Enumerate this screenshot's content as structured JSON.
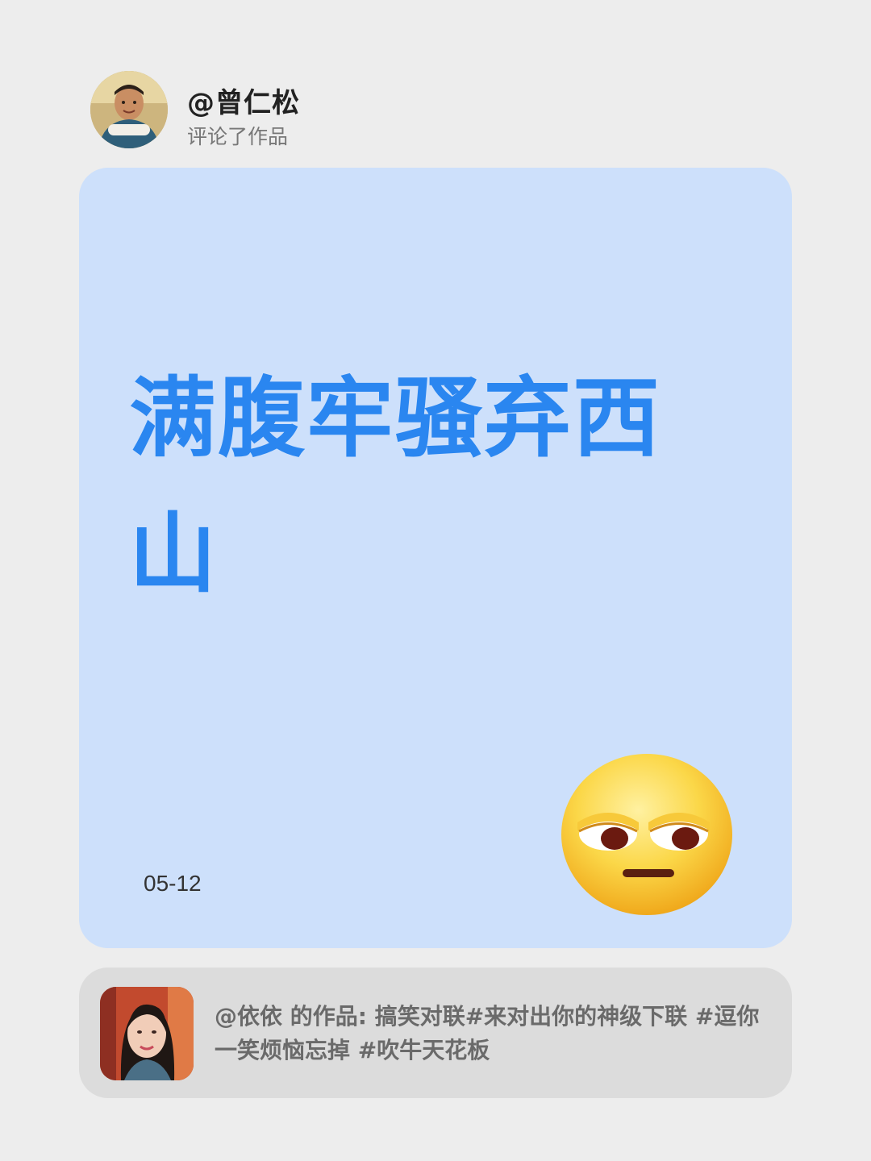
{
  "header": {
    "username": "@曾仁松",
    "action": "评论了作品"
  },
  "comment": {
    "text": "满腹牢骚弃西山",
    "date": "05-12",
    "emoji": "unamused-face-emoji"
  },
  "source": {
    "text": "@依依 的作品: 搞笑对联#来对出你的神级下联 #逗你一笑烦恼忘掉 #吹牛天花板"
  },
  "colors": {
    "background": "#ededed",
    "card": "#cde0fb",
    "accent_text": "#2a86f0",
    "source_card": "#dcdcdc"
  }
}
